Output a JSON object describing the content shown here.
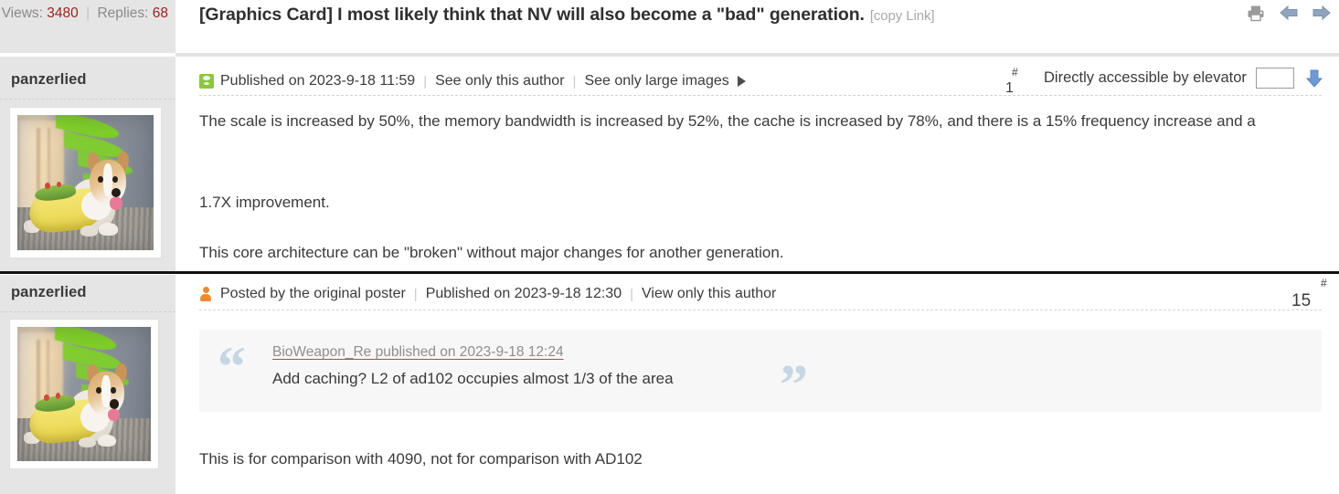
{
  "stats": {
    "views_label": "Views:",
    "views_value": "3480",
    "divider": "|",
    "replies_label": "Replies:",
    "replies_value": "68"
  },
  "thread": {
    "title": "[Graphics Card] I most likely think that NV will also become a \"bad\" generation.",
    "copy_link": "[copy Link]"
  },
  "toolbar": {
    "print_icon": "print-icon",
    "prev_icon": "arrow-left-icon",
    "next_icon": "arrow-right-icon"
  },
  "posts": [
    {
      "author": "panzerlied",
      "avatar_alt": "corgi dog in taco costume in front of nvidia logo",
      "meta": {
        "published": "Published on 2023-9-18 11:59",
        "see_only_author": "See only this author",
        "see_large_images": "See only large images",
        "separator": "|"
      },
      "floor_hash": "#",
      "floor_number": "1",
      "elevator_label": "Directly accessible by elevator",
      "elevator_input_value": "",
      "elevator_input_placeholder": "",
      "paragraphs": [
        "The scale is increased by 50%, the memory bandwidth is increased by 52%, the cache is increased by 78%, and there is a 15% frequency increase and a",
        "1.7X improvement.",
        "This core architecture can be \"broken\" without major changes for another generation."
      ]
    },
    {
      "author": "panzerlied",
      "avatar_alt": "corgi dog in taco costume in front of nvidia logo",
      "meta": {
        "posted_by_op": "Posted by the original poster",
        "published": "Published on 2023-9-18 12:30",
        "view_only_author": "View only this author",
        "separator": "|"
      },
      "floor_hash": "#",
      "floor_number": "15",
      "quote": {
        "head": "BioWeapon_Re published on 2023-9-18 12:24",
        "body": "Add caching? L2 of ad102 occupies almost 1/3 of the area",
        "open_mark": "“",
        "close_mark": "”"
      },
      "paragraphs": [
        "This is for comparison with 4090, not for comparison with AD102"
      ]
    }
  ],
  "colors": {
    "sidebar_bg": "#e5e5e5",
    "stat_number": "#9b2222",
    "muted": "#8e8e8e",
    "accent_green": "#8cc63e",
    "accent_orange": "#f08a2c",
    "arrow_blue": "#5b8fd0",
    "quote_bg": "#f7f7f7",
    "quote_mark": "#c6d6e3"
  }
}
